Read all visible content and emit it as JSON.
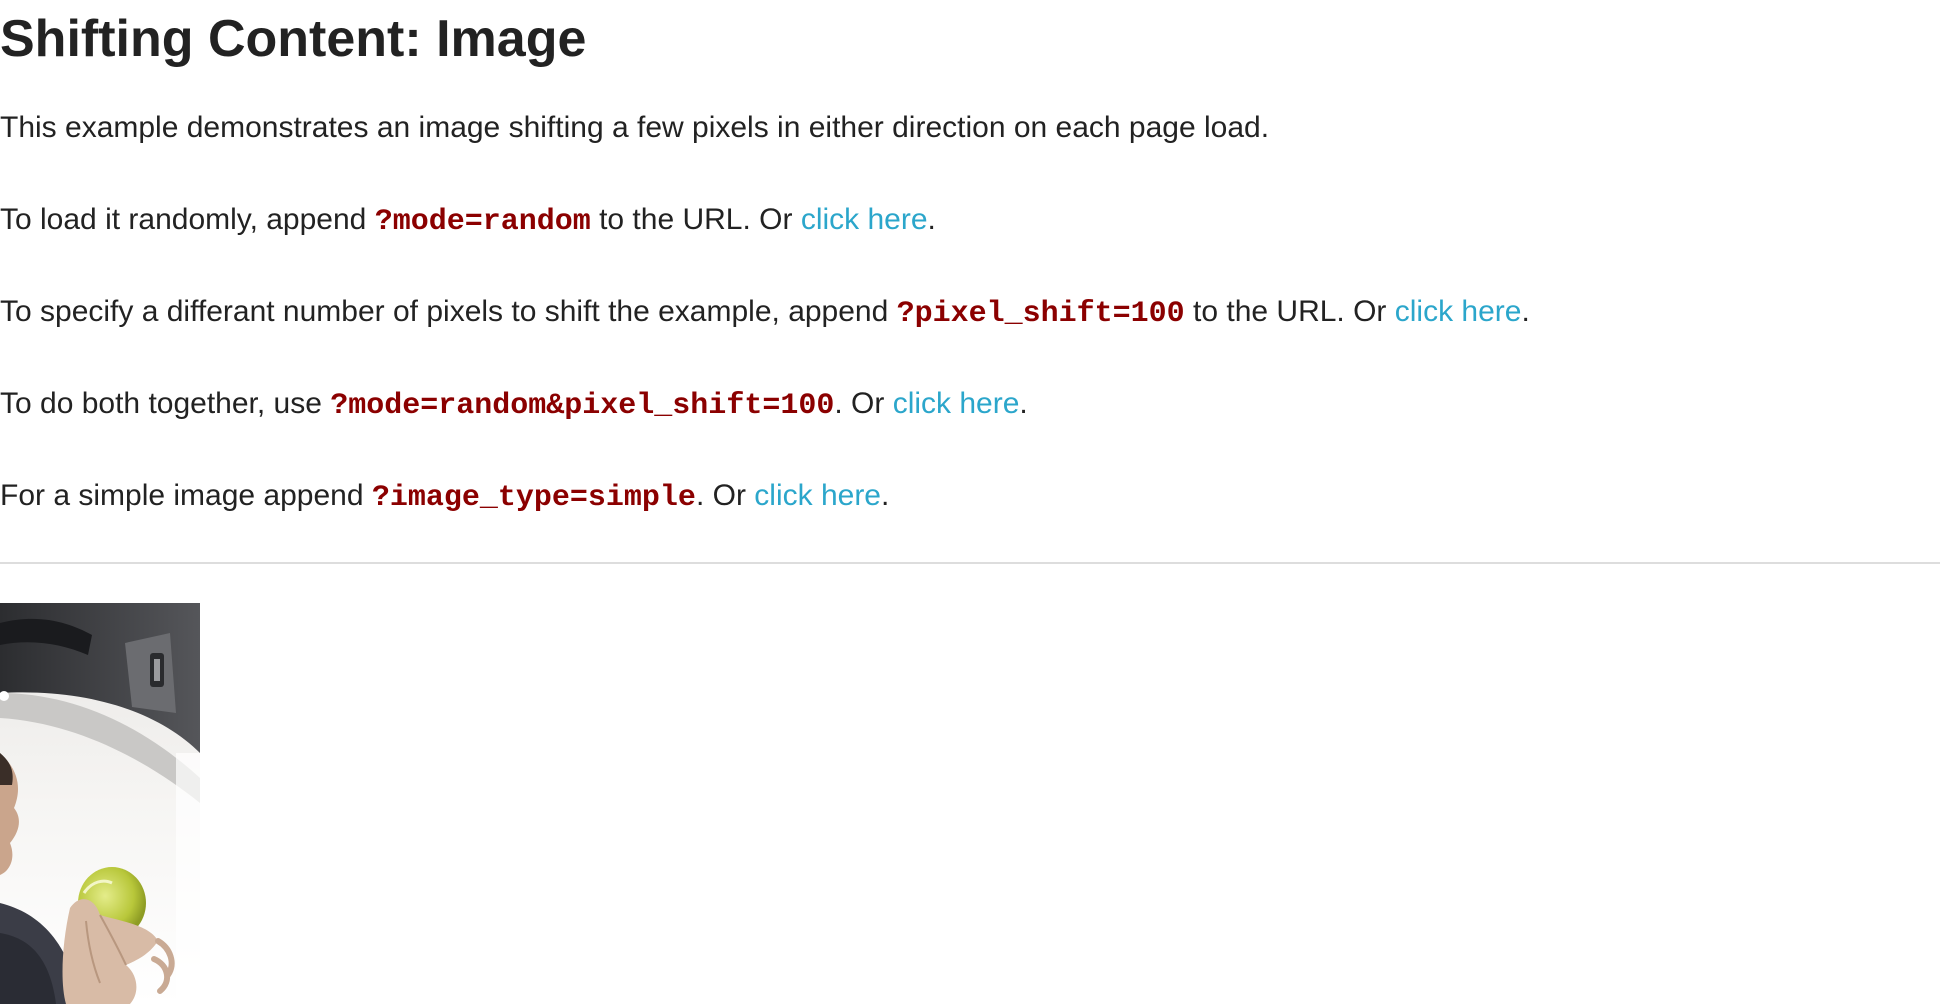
{
  "page": {
    "title": "Shifting Content: Image"
  },
  "intro": {
    "text": "This example demonstrates an image shifting a few pixels in either direction on each page load."
  },
  "random_mode": {
    "prefix": "To load it randomly, append ",
    "param": "?mode=random",
    "middle": " to the URL. Or ",
    "link_label": "click here",
    "suffix": "."
  },
  "pixel_shift": {
    "prefix": "To specify a differant number of pixels to shift the example, append ",
    "param": "?pixel_shift=100",
    "middle": " to the URL. Or ",
    "link_label": "click here",
    "suffix": "."
  },
  "both": {
    "prefix": "To do both together, use ",
    "param": "?mode=random&pixel_shift=100",
    "middle": ". Or ",
    "link_label": "click here",
    "suffix": "."
  },
  "simple_image": {
    "prefix": "For a simple image append ",
    "param": "?image_type=simple",
    "middle": ". Or ",
    "link_label": "click here",
    "suffix": "."
  },
  "colors": {
    "text": "#222222",
    "link": "#2ba6cb",
    "code": "#8b0000",
    "divider": "#dddddd"
  }
}
